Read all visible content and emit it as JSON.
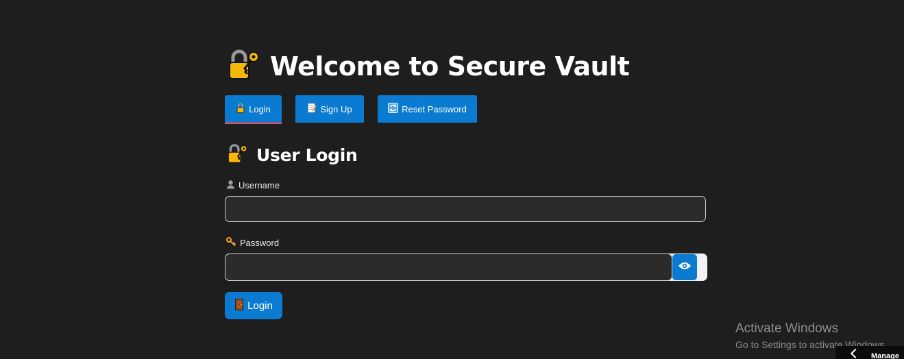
{
  "app": {
    "title": "Welcome to Secure Vault",
    "title_icon": "lock-with-key-icon"
  },
  "tabs": [
    {
      "label": "Login",
      "icon": "lock-icon",
      "active": true
    },
    {
      "label": "Sign Up",
      "icon": "memo-icon",
      "active": false
    },
    {
      "label": "Reset Password",
      "icon": "refresh-icon",
      "active": false
    }
  ],
  "form": {
    "heading": "User Login",
    "heading_icon": "lock-with-key-icon",
    "username": {
      "label": "Username",
      "icon": "user-silhouette-icon",
      "value": ""
    },
    "password": {
      "label": "Password",
      "icon": "key-icon",
      "value": "",
      "toggle_icon": "eye-icon"
    },
    "submit": {
      "label": "Login",
      "icon": "door-icon"
    }
  },
  "system": {
    "activate_title": "Activate Windows",
    "activate_subtitle": "Go to Settings to activate Windows.",
    "taskbar_label": "Manage"
  },
  "colors": {
    "background": "#1e1e1e",
    "accent": "#0a7bd0",
    "active_tab_underline": "#ff4b4b",
    "input_bg": "#2b2b2c"
  }
}
